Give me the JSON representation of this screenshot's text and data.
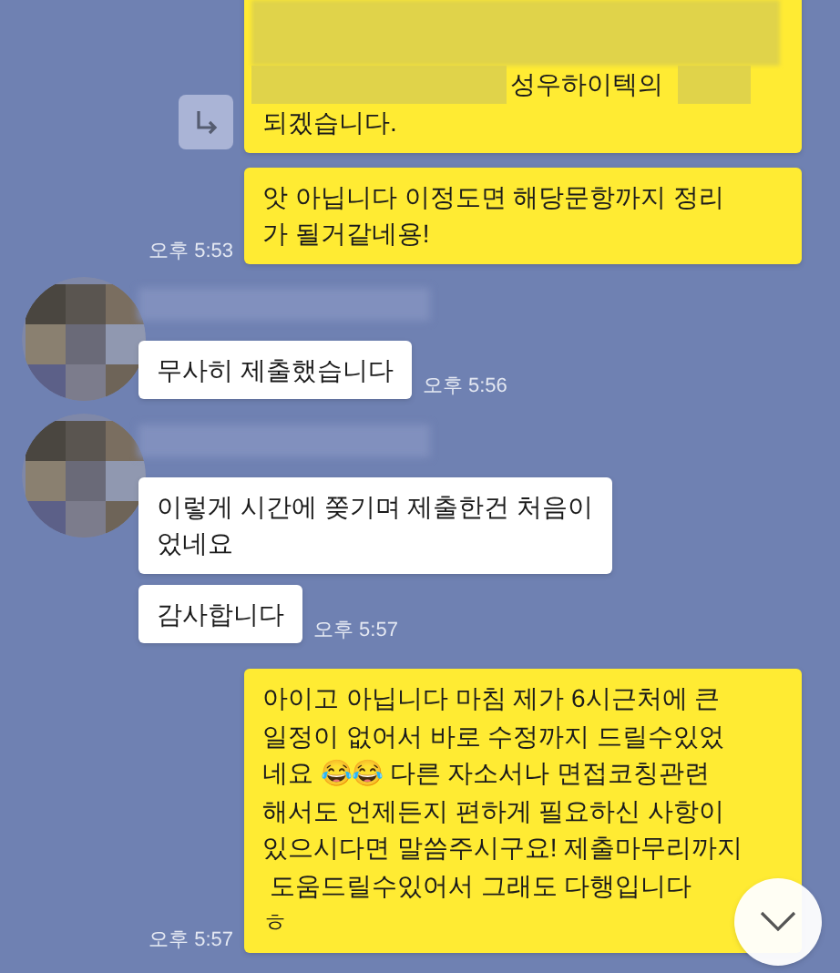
{
  "messages": [
    {
      "kind": "sent",
      "reply_icon": true,
      "redacted": true,
      "lines": [
        "성우하이텍의",
        "되겠습니다."
      ]
    },
    {
      "kind": "sent",
      "lines": [
        "앗 아닙니다 이정도면 해당문항까지 정리",
        "가 될거같네용!"
      ],
      "time": "오후 5:53"
    },
    {
      "kind": "received",
      "avatar": {
        "kind": "picture"
      },
      "lines": [
        "무사히 제출했습니다"
      ],
      "time": "오후 5:56"
    },
    {
      "kind": "received",
      "avatar": {
        "kind": "picture"
      },
      "lines": [
        "이렇게 시간에 쫒기며 제출한건 처음이",
        "었네요"
      ]
    },
    {
      "kind": "received",
      "lines": [
        "감사합니다"
      ],
      "time": "오후 5:57"
    },
    {
      "kind": "sent",
      "lines": [
        "아이고 아닙니다 마침 제가 6시근처에 큰",
        "일정이 없어서 바로 수정까지 드릴수있었",
        "네요 😂😂 다른 자소서나 면접코칭관련",
        "해서도 언제든지 편하게 필요하신 사항이",
        "있으시다면 말씀주시구요! 제출마무리까지",
        " 도움드릴수있어서 그래도 다행입니다",
        "ㅎ"
      ],
      "time": "오후 5:57"
    }
  ],
  "scroll_down_button": true
}
